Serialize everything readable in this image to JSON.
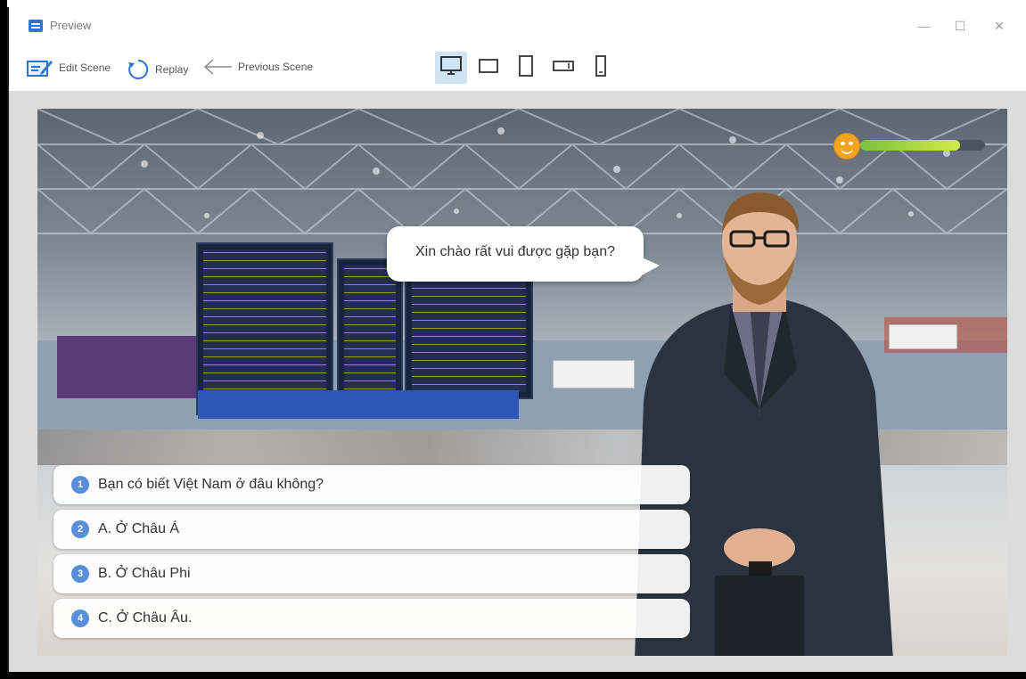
{
  "window": {
    "title": "Preview",
    "minimize_glyph": "—",
    "maximize_glyph": "☐",
    "close_glyph": "✕"
  },
  "toolbar": {
    "edit_scene_label": "Edit Scene",
    "replay_label": "Replay",
    "previous_scene_label": "Previous Scene",
    "devices": [
      {
        "icon": "desktop-icon",
        "active": true
      },
      {
        "icon": "tablet-landscape-icon",
        "active": false
      },
      {
        "icon": "tablet-portrait-icon",
        "active": false
      },
      {
        "icon": "phone-landscape-icon",
        "active": false
      },
      {
        "icon": "phone-portrait-icon",
        "active": false
      }
    ]
  },
  "scene": {
    "speech_bubble": "Xin chào rất vui được gặp bạn?",
    "score_fraction": 0.8,
    "answers": [
      {
        "number": "1",
        "text": "Bạn có biết Việt Nam ở đâu không?"
      },
      {
        "number": "2",
        "text": "A. Ở Châu Á"
      },
      {
        "number": "3",
        "text": "B. Ở Châu Phi"
      },
      {
        "number": "4",
        "text": "C. Ở Châu Âu."
      }
    ]
  },
  "colors": {
    "accent": "#2b73d6",
    "active_device_bg": "#cfe4f5",
    "number_badge": "#5b8ed8",
    "progress_start": "#7bc043",
    "progress_end": "#d4e84a"
  }
}
